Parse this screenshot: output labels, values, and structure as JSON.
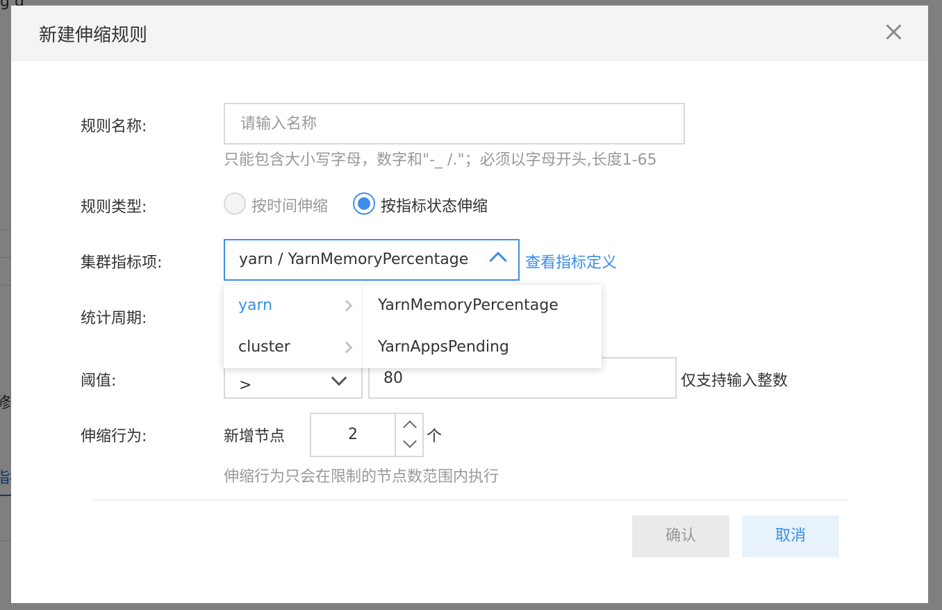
{
  "background": {
    "frag_top": "g g",
    "frag_left1": "修",
    "frag_left2": "指标"
  },
  "dialog": {
    "title": "新建伸缩规则",
    "close_icon": "close-icon"
  },
  "form": {
    "rule_name": {
      "label": "规则名称:",
      "placeholder": "请输入名称",
      "value": "",
      "hint": "只能包含大小写字母，数字和\"-_ /.\"；必须以字母开头,长度1-65"
    },
    "rule_type": {
      "label": "规则类型:",
      "options": [
        {
          "label": "按时间伸缩",
          "checked": false,
          "disabled": true
        },
        {
          "label": "按指标状态伸缩",
          "checked": true,
          "disabled": false
        }
      ]
    },
    "metric": {
      "label": "集群指标项:",
      "value": "yarn / YarnMemoryPercentage",
      "link": "查看指标定义",
      "cascader": {
        "level1": [
          {
            "label": "yarn",
            "active": true
          },
          {
            "label": "cluster",
            "active": false
          }
        ],
        "level2": [
          {
            "label": "YarnMemoryPercentage"
          },
          {
            "label": "YarnAppsPending"
          }
        ]
      }
    },
    "period": {
      "label": "统计周期:"
    },
    "threshold": {
      "label": "阈值:",
      "operator": ">",
      "value": "80",
      "note": "仅支持输入整数"
    },
    "action": {
      "label": "伸缩行为:",
      "prefix": "新增节点",
      "count": "2",
      "unit": "个",
      "hint": "伸缩行为只会在限制的节点数范围内执行"
    }
  },
  "footer": {
    "confirm": "确认",
    "cancel": "取消"
  },
  "colors": {
    "accent": "#3f8ee8",
    "link": "#3a8ee6",
    "overlay": "rgba(0,0,0,0.5)"
  }
}
